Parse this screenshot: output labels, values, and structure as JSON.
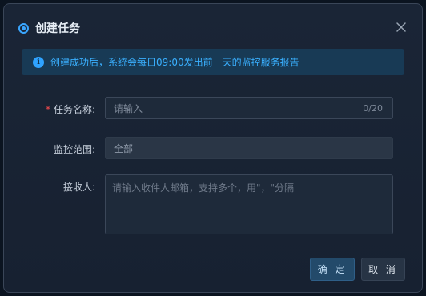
{
  "dialog": {
    "title": "创建任务",
    "close_icon": "close-icon",
    "alert_icon": "info-icon",
    "alert_icon_glyph": "i",
    "alert_text": "创建成功后，系统会每日09:00发出前一天的监控服务报告"
  },
  "form": {
    "task_name": {
      "required_mark": "*",
      "label": "任务名称:",
      "placeholder": "请输入",
      "counter": "0/20"
    },
    "scope": {
      "label": "监控范围:",
      "value": "全部"
    },
    "recipients": {
      "label": "接收人:",
      "placeholder": "请输入收件人邮箱，支持多个，用\"，\"分隔"
    }
  },
  "buttons": {
    "confirm": "确 定",
    "cancel": "取 消"
  },
  "colors": {
    "accent": "#3aa6ff",
    "required": "#ff4d4f",
    "alert_bg": "#183a55"
  }
}
